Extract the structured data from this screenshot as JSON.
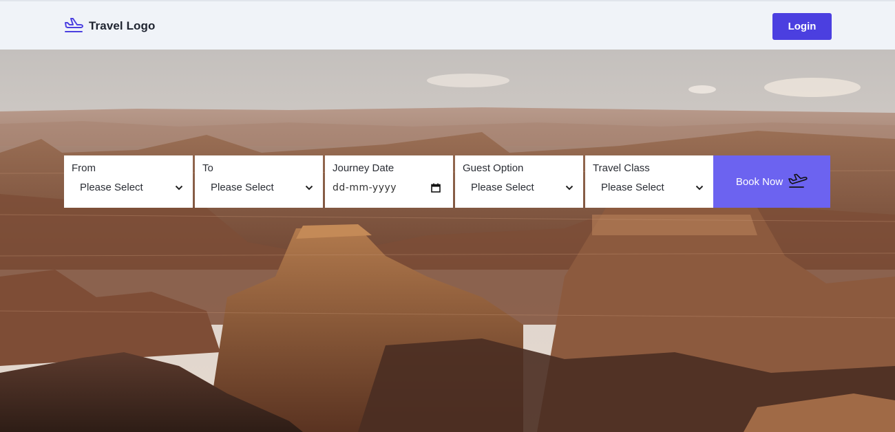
{
  "header": {
    "logo_icon": "airplane-takeoff-icon",
    "logo_text": "Travel Logo",
    "login_label": "Login",
    "accent_color": "#4b3fe0"
  },
  "hero": {
    "background": "grand-canyon-landscape-photo"
  },
  "booking": {
    "from": {
      "label": "From",
      "value": "Please Select"
    },
    "to": {
      "label": "To",
      "value": "Please Select"
    },
    "journey_date": {
      "label": "Journey Date",
      "placeholder": "dd-mm-yyyy",
      "icon": "calendar-icon"
    },
    "guest_option": {
      "label": "Guest Option",
      "value": "Please Select"
    },
    "travel_class": {
      "label": "Travel Class",
      "value": "Please Select"
    },
    "book_now": {
      "label": "Book Now",
      "icon": "airplane-takeoff-icon",
      "color": "#6c63f0"
    }
  }
}
